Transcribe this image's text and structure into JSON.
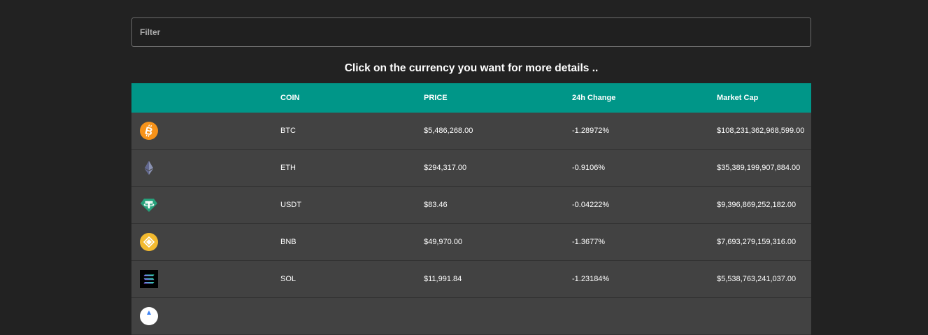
{
  "filter": {
    "placeholder": "Filter"
  },
  "instruction": "Click on the currency you want for more details ..",
  "table": {
    "headers": {
      "icon": "",
      "coin": "COIN",
      "price": "PRICE",
      "change": "24h Change",
      "market_cap": "Market Cap"
    },
    "rows": [
      {
        "icon": "bitcoin-icon",
        "coin": "BTC",
        "price": "$5,486,268.00",
        "change": "-1.28972%",
        "market_cap": "$108,231,362,968,599.00"
      },
      {
        "icon": "ethereum-icon",
        "coin": "ETH",
        "price": "$294,317.00",
        "change": "-0.9106%",
        "market_cap": "$35,389,199,907,884.00"
      },
      {
        "icon": "tether-icon",
        "coin": "USDT",
        "price": "$83.46",
        "change": "-0.04222%",
        "market_cap": "$9,396,869,252,182.00"
      },
      {
        "icon": "bnb-icon",
        "coin": "BNB",
        "price": "$49,970.00",
        "change": "-1.3677%",
        "market_cap": "$7,693,279,159,316.00"
      },
      {
        "icon": "solana-icon",
        "coin": "SOL",
        "price": "$11,991.84",
        "change": "-1.23184%",
        "market_cap": "$5,538,763,241,037.00"
      }
    ]
  },
  "colors": {
    "page_bg": "#222222",
    "header_bg": "#009688",
    "row_bg": "#424242",
    "bitcoin": "#f7931a",
    "tether": "#26a17b",
    "bnb": "#f3ba2f"
  }
}
